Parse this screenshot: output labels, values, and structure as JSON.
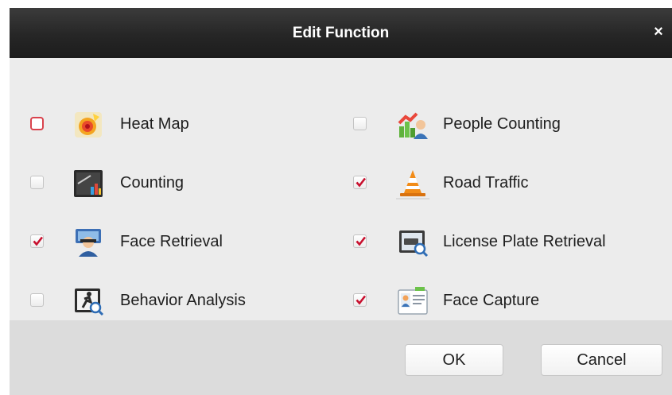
{
  "dialog": {
    "title": "Edit Function",
    "close_label": "×"
  },
  "functions": [
    {
      "label": "Heat Map",
      "checked": false
    },
    {
      "label": "People Counting",
      "checked": false
    },
    {
      "label": "Counting",
      "checked": false
    },
    {
      "label": "Road Traffic",
      "checked": true
    },
    {
      "label": "Face Retrieval",
      "checked": true
    },
    {
      "label": "License Plate Retrieval",
      "checked": true
    },
    {
      "label": "Behavior Analysis",
      "checked": false
    },
    {
      "label": "Face Capture",
      "checked": true
    }
  ],
  "buttons": {
    "ok": "OK",
    "cancel": "Cancel"
  },
  "colors": {
    "checkmark": "#c8102e",
    "titlebar": "#262626"
  }
}
